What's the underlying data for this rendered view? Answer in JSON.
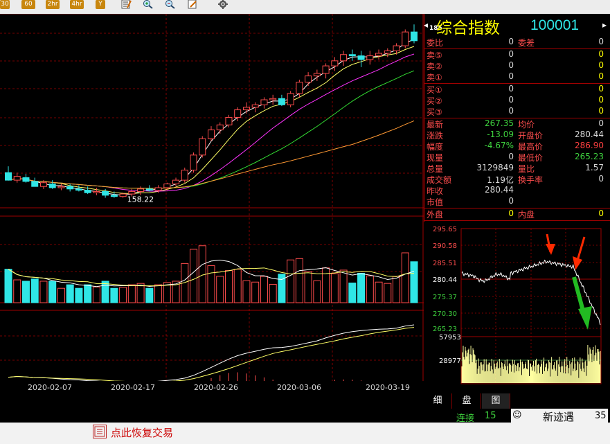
{
  "toolbar": {
    "buttons": [
      "30",
      "60",
      "2hr",
      "4hr",
      "Y"
    ]
  },
  "title": {
    "name": "综合指数",
    "code": "100001",
    "arrow_left": "◂",
    "arrow_right": "▸",
    "side_top_label": "185"
  },
  "quote": {
    "wb_label": "委比",
    "wb_val": "0",
    "wc_label": "委差",
    "wc_val": "0",
    "sell": [
      {
        "label": "卖⑤",
        "price": "0",
        "vol": "0"
      },
      {
        "label": "卖②",
        "price": "0",
        "vol": "0"
      },
      {
        "label": "卖①",
        "price": "0",
        "vol": "0"
      }
    ],
    "buy": [
      {
        "label": "买①",
        "price": "0",
        "vol": "0"
      },
      {
        "label": "买②",
        "price": "0",
        "vol": "0"
      },
      {
        "label": "买③",
        "price": "0",
        "vol": "0"
      }
    ],
    "stats": [
      {
        "l1": "最新",
        "v1": "267.35",
        "c1": "green",
        "l2": "均价",
        "v2": "0",
        "c2": "white"
      },
      {
        "l1": "涨跌",
        "v1": "-13.09",
        "c1": "green",
        "l2": "开盘价",
        "v2": "280.44",
        "c2": "white"
      },
      {
        "l1": "幅度",
        "v1": "-4.67%",
        "c1": "green",
        "l2": "最高价",
        "v2": "286.90",
        "c2": "red"
      },
      {
        "l1": "现量",
        "v1": "0",
        "c1": "white",
        "l2": "最低价",
        "v2": "265.23",
        "c2": "green"
      },
      {
        "l1": "总量",
        "v1": "3129849",
        "c1": "white",
        "l2": "量比",
        "v2": "1.57",
        "c2": "white"
      },
      {
        "l1": "成交额",
        "v1": "1.19亿",
        "c1": "white",
        "l2": "换手率",
        "v2": "0",
        "c2": "white"
      },
      {
        "l1": "昨收",
        "v1": "280.44",
        "c1": "white",
        "l2": "",
        "v2": "",
        "c2": "white"
      },
      {
        "l1": "市值",
        "v1": "0",
        "c1": "white",
        "l2": "",
        "v2": "",
        "c2": "white"
      }
    ],
    "outer_label": "外盘",
    "outer_val": "0",
    "inner_label": "内盘",
    "inner_val": "0"
  },
  "chart_data": [
    {
      "type": "candlestick",
      "title": "",
      "xlabel": "",
      "ylabel": "",
      "x_tick_labels": [
        "2020-02-07",
        "2020-02-17",
        "2020-02-26",
        "2020-03-06",
        "2020-03-19"
      ],
      "min_label": "158.22",
      "candles": [
        {
          "o": 178,
          "h": 183,
          "l": 172,
          "c": 172,
          "up": false
        },
        {
          "o": 172,
          "h": 178,
          "l": 170,
          "c": 175,
          "up": true
        },
        {
          "o": 174,
          "h": 177,
          "l": 170,
          "c": 171,
          "up": false
        },
        {
          "o": 171,
          "h": 174,
          "l": 167,
          "c": 167,
          "up": false
        },
        {
          "o": 167,
          "h": 172,
          "l": 165,
          "c": 170,
          "up": true
        },
        {
          "o": 169,
          "h": 172,
          "l": 165,
          "c": 166,
          "up": false
        },
        {
          "o": 166,
          "h": 169,
          "l": 164,
          "c": 167,
          "up": true
        },
        {
          "o": 167,
          "h": 169,
          "l": 163,
          "c": 165,
          "up": false
        },
        {
          "o": 165,
          "h": 168,
          "l": 163,
          "c": 164,
          "up": false
        },
        {
          "o": 164,
          "h": 167,
          "l": 161,
          "c": 162,
          "up": false
        },
        {
          "o": 162,
          "h": 166,
          "l": 160,
          "c": 163,
          "up": true
        },
        {
          "o": 163,
          "h": 165,
          "l": 158,
          "c": 160,
          "up": false
        },
        {
          "o": 160,
          "h": 163,
          "l": 158,
          "c": 159,
          "up": false
        },
        {
          "o": 159,
          "h": 162,
          "l": 158,
          "c": 161,
          "up": true
        },
        {
          "o": 161,
          "h": 165,
          "l": 159,
          "c": 163,
          "up": true
        },
        {
          "o": 163,
          "h": 167,
          "l": 160,
          "c": 165,
          "up": true
        },
        {
          "o": 165,
          "h": 168,
          "l": 163,
          "c": 164,
          "up": false
        },
        {
          "o": 164,
          "h": 168,
          "l": 162,
          "c": 166,
          "up": true
        },
        {
          "o": 166,
          "h": 170,
          "l": 164,
          "c": 169,
          "up": true
        },
        {
          "o": 169,
          "h": 174,
          "l": 167,
          "c": 172,
          "up": true
        },
        {
          "o": 172,
          "h": 182,
          "l": 170,
          "c": 180,
          "up": true
        },
        {
          "o": 180,
          "h": 194,
          "l": 178,
          "c": 192,
          "up": true
        },
        {
          "o": 192,
          "h": 207,
          "l": 190,
          "c": 205,
          "up": true
        },
        {
          "o": 205,
          "h": 215,
          "l": 203,
          "c": 212,
          "up": true
        },
        {
          "o": 212,
          "h": 218,
          "l": 209,
          "c": 216,
          "up": true
        },
        {
          "o": 216,
          "h": 224,
          "l": 214,
          "c": 222,
          "up": true
        },
        {
          "o": 222,
          "h": 230,
          "l": 219,
          "c": 228,
          "up": true
        },
        {
          "o": 228,
          "h": 234,
          "l": 225,
          "c": 230,
          "up": true
        },
        {
          "o": 230,
          "h": 234,
          "l": 226,
          "c": 232,
          "up": true
        },
        {
          "o": 232,
          "h": 238,
          "l": 229,
          "c": 236,
          "up": true
        },
        {
          "o": 236,
          "h": 240,
          "l": 232,
          "c": 237,
          "up": true
        },
        {
          "o": 237,
          "h": 240,
          "l": 231,
          "c": 232,
          "up": false
        },
        {
          "o": 232,
          "h": 243,
          "l": 230,
          "c": 241,
          "up": true
        },
        {
          "o": 241,
          "h": 252,
          "l": 238,
          "c": 250,
          "up": true
        },
        {
          "o": 250,
          "h": 258,
          "l": 247,
          "c": 255,
          "up": true
        },
        {
          "o": 255,
          "h": 260,
          "l": 251,
          "c": 257,
          "up": true
        },
        {
          "o": 257,
          "h": 265,
          "l": 253,
          "c": 263,
          "up": true
        },
        {
          "o": 263,
          "h": 270,
          "l": 259,
          "c": 267,
          "up": true
        },
        {
          "o": 267,
          "h": 275,
          "l": 263,
          "c": 272,
          "up": true
        },
        {
          "o": 272,
          "h": 276,
          "l": 267,
          "c": 271,
          "up": false
        },
        {
          "o": 271,
          "h": 275,
          "l": 262,
          "c": 268,
          "up": false
        },
        {
          "o": 268,
          "h": 275,
          "l": 264,
          "c": 271,
          "up": true
        },
        {
          "o": 271,
          "h": 276,
          "l": 268,
          "c": 273,
          "up": true
        },
        {
          "o": 273,
          "h": 277,
          "l": 270,
          "c": 275,
          "up": true
        },
        {
          "o": 275,
          "h": 281,
          "l": 272,
          "c": 279,
          "up": true
        },
        {
          "o": 279,
          "h": 292,
          "l": 277,
          "c": 290,
          "up": true
        },
        {
          "o": 290,
          "h": 296,
          "l": 281,
          "c": 283,
          "up": false
        }
      ],
      "ma_colors": [
        "#ffffff",
        "#ffff66",
        "#ff33ff",
        "#33dd33",
        "#ff9933"
      ]
    },
    {
      "type": "line",
      "title": "",
      "y_tick_labels": [
        "295.65",
        "290.58",
        "285.51",
        "280.44",
        "275.37",
        "270.30",
        "265.23"
      ],
      "ylim": [
        265.23,
        295.65
      ],
      "vol_labels": [
        "57953",
        "28977"
      ]
    }
  ],
  "tabs": [
    "细",
    "盘",
    "图"
  ],
  "status": {
    "connect": "连接",
    "count": "15",
    "time_tail": "35",
    "watermark": "新迹遇"
  },
  "bottom": {
    "restore": "点此恢复交易"
  }
}
